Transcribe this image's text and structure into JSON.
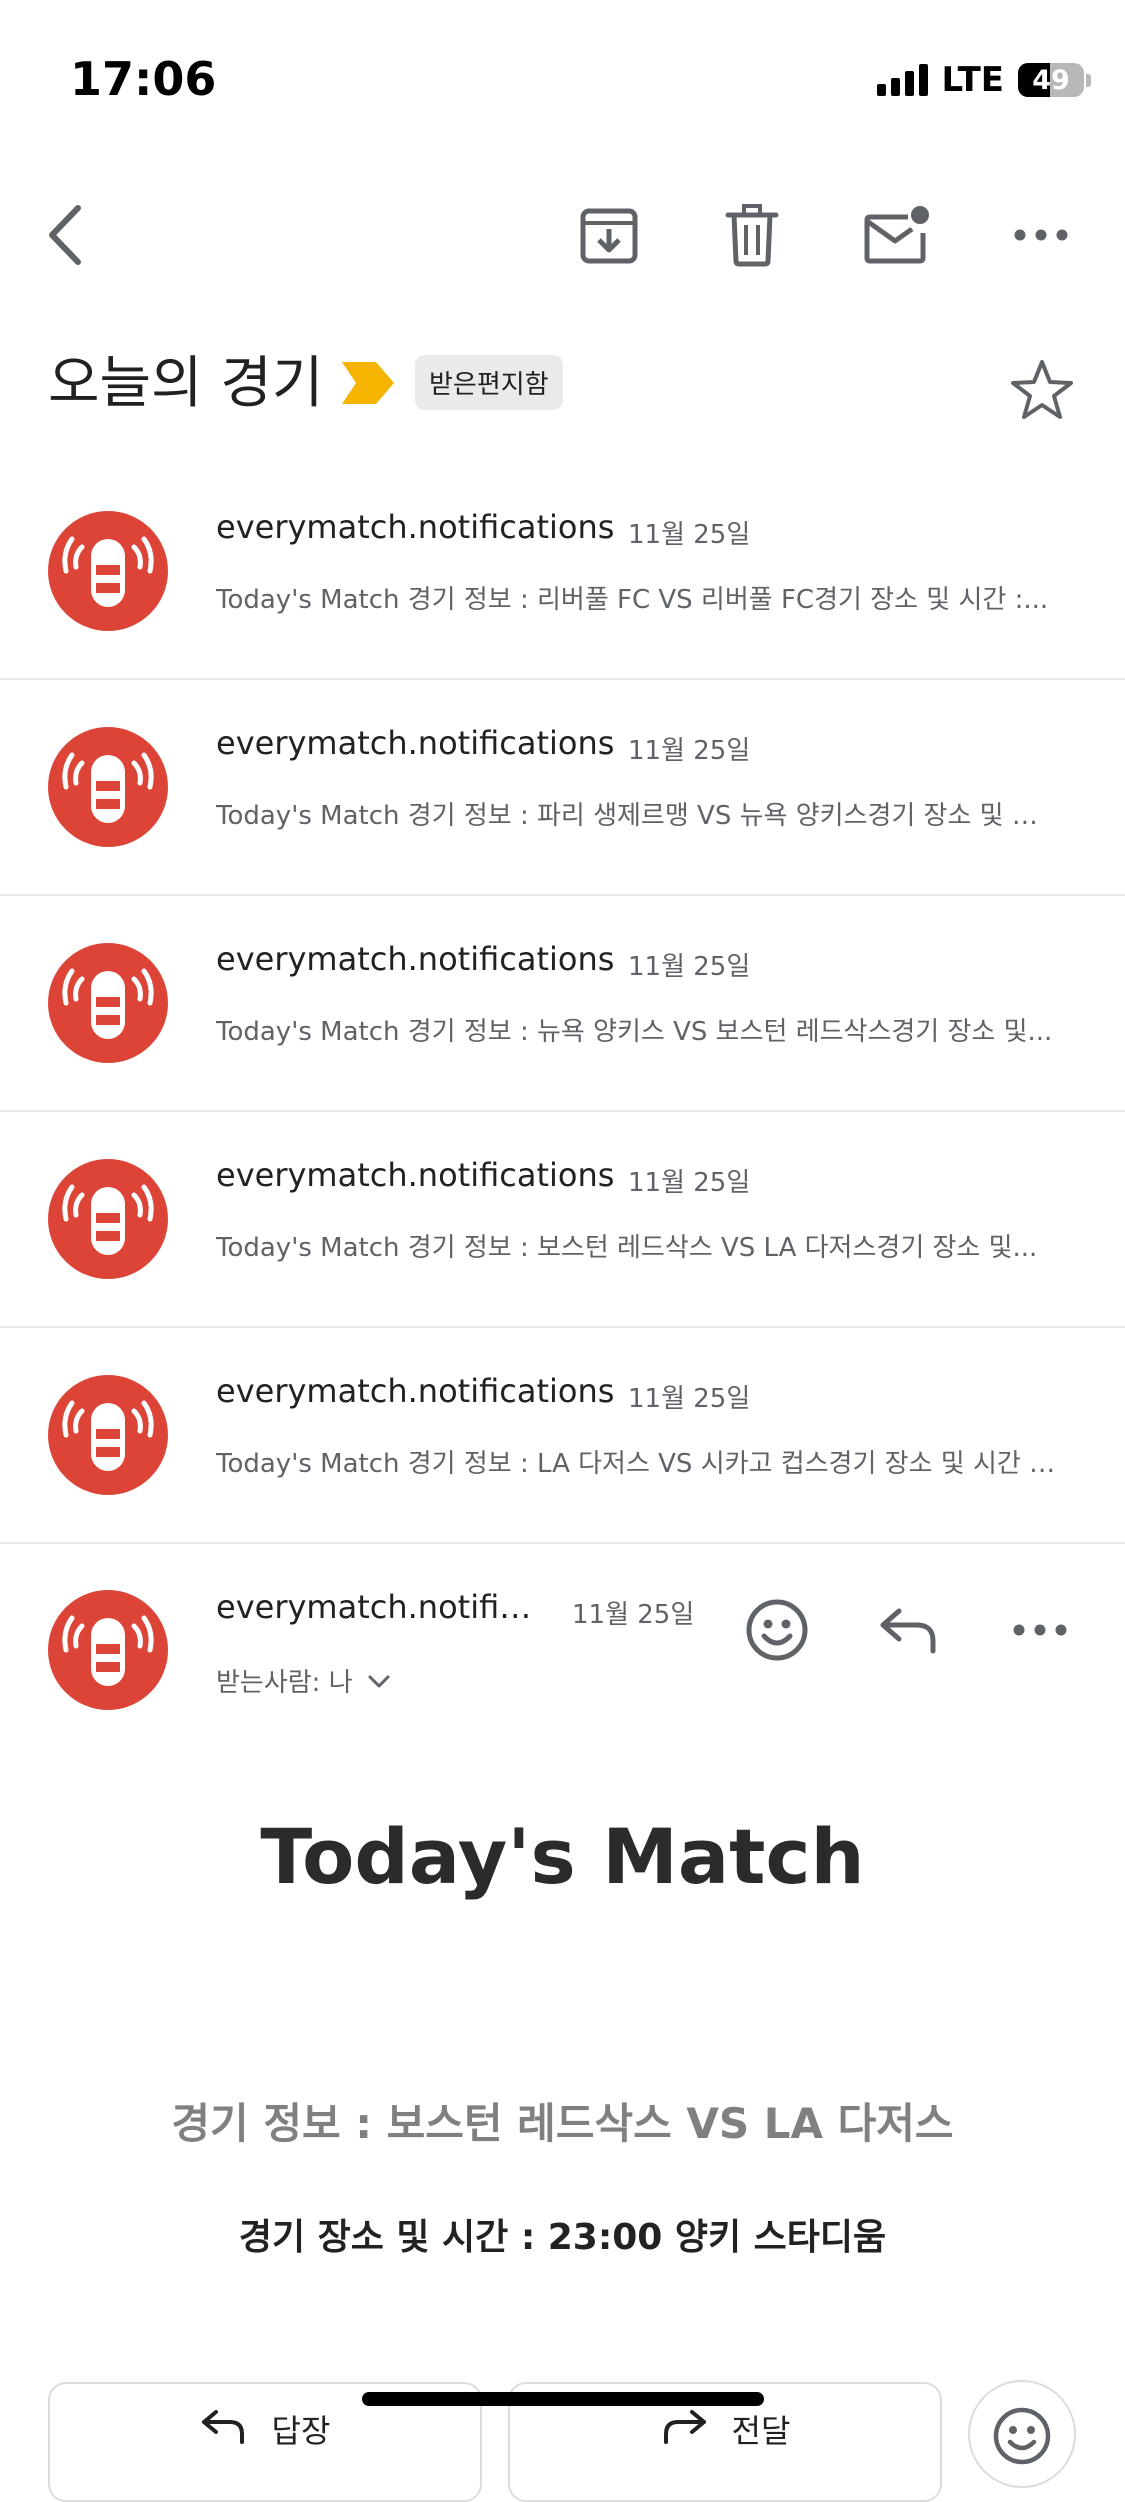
{
  "status_bar": {
    "time": "17:06",
    "network": "LTE",
    "battery_level": "49"
  },
  "toolbar": {
    "icons": [
      "back-arrow-icon",
      "archive-icon",
      "trash-icon",
      "mark-unread-icon",
      "more-icon"
    ]
  },
  "thread": {
    "subject": "오늘의 경기",
    "label": "받은편지함",
    "importance_color": "#f4b400"
  },
  "messages": [
    {
      "sender": "everymatch.notifications",
      "date": "11월 25일",
      "snippet": "Today's Match 경기 정보 : 리버풀 FC VS 리버풀 FC경기 장소 및 시간 :..."
    },
    {
      "sender": "everymatch.notifications",
      "date": "11월 25일",
      "snippet": "Today's Match 경기 정보 : 파리 생제르맹 VS 뉴욕 양키스경기 장소 및 시..."
    },
    {
      "sender": "everymatch.notifications",
      "date": "11월 25일",
      "snippet": "Today's Match 경기 정보 : 뉴욕 양키스 VS 보스턴 레드삭스경기 장소 및..."
    },
    {
      "sender": "everymatch.notifications",
      "date": "11월 25일",
      "snippet": "Today's Match 경기 정보 : 보스턴 레드삭스 VS LA 다저스경기 장소 및..."
    },
    {
      "sender": "everymatch.notifications",
      "date": "11월 25일",
      "snippet": "Today's Match 경기 정보 : LA 다저스 VS 시카고 컵스경기 장소 및 시간 :..."
    }
  ],
  "expanded": {
    "sender": "everymatch.notifications",
    "date": "11월 25일",
    "recipients": "받는사람: 나",
    "heading": "Today's Match",
    "match_info": "경기 정보 : 보스턴 레드삭스 VS LA 다저스",
    "match_time": "경기 장소 및 시간 : 23:00 양키 스타디움",
    "reply_label": "답장",
    "forward_label": "전달"
  },
  "colors": {
    "avatar_red": "#db4437",
    "icon_gray": "#5f6368"
  }
}
